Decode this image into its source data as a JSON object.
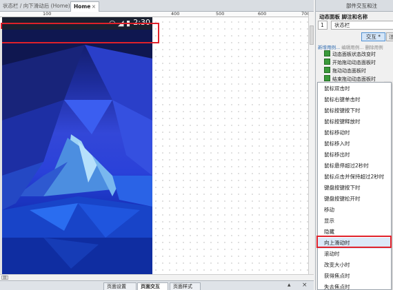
{
  "tabs": {
    "inactive_label": "状态栏 / 向下滑动后 (Home)",
    "active_label": "Home",
    "close_glyph": "×"
  },
  "ruler": {
    "labels": [
      "100",
      "400",
      "500",
      "600",
      "700"
    ]
  },
  "phone": {
    "time": "2:30",
    "icons": [
      "wifi-icon",
      "signal-icon",
      "battery-icon"
    ]
  },
  "right_panel": {
    "title": "部件交互和注",
    "subtitle": "动态面板 脚注和名称",
    "page_number": "1",
    "name_value": "状态栏",
    "interact_button": "交互 *",
    "note_button": "注",
    "link_new": "新增用例...",
    "link_edit": "编辑用例...",
    "link_delete": "删除用例",
    "events": [
      "动态面板状态改变时",
      "开始拖动动态面板时",
      "拖动动态面板时",
      "结束拖动动态面板时"
    ]
  },
  "menu": {
    "items": [
      "鼠标双击时",
      "鼠标右键单击时",
      "鼠标按键按下时",
      "鼠标按键释放时",
      "鼠标移动时",
      "鼠标移入时",
      "鼠标移出时",
      "鼠标悬停超过2秒时",
      "鼠标点击并保持超过2秒时",
      "键盘按键按下时",
      "键盘按键松开时",
      "移动",
      "显示",
      "隐藏",
      "向上滑动时",
      "滚动时",
      "改变大小时",
      "获得焦点时",
      "失去焦点时"
    ],
    "highlighted_index": 14
  },
  "bottom_tabs": [
    "页面设置",
    "页面交互",
    "页面样式"
  ],
  "colors": {
    "highlight_red": "#e0212a",
    "selection_blue": "#dbe9f8",
    "accent_green": "#3a9a3a"
  }
}
